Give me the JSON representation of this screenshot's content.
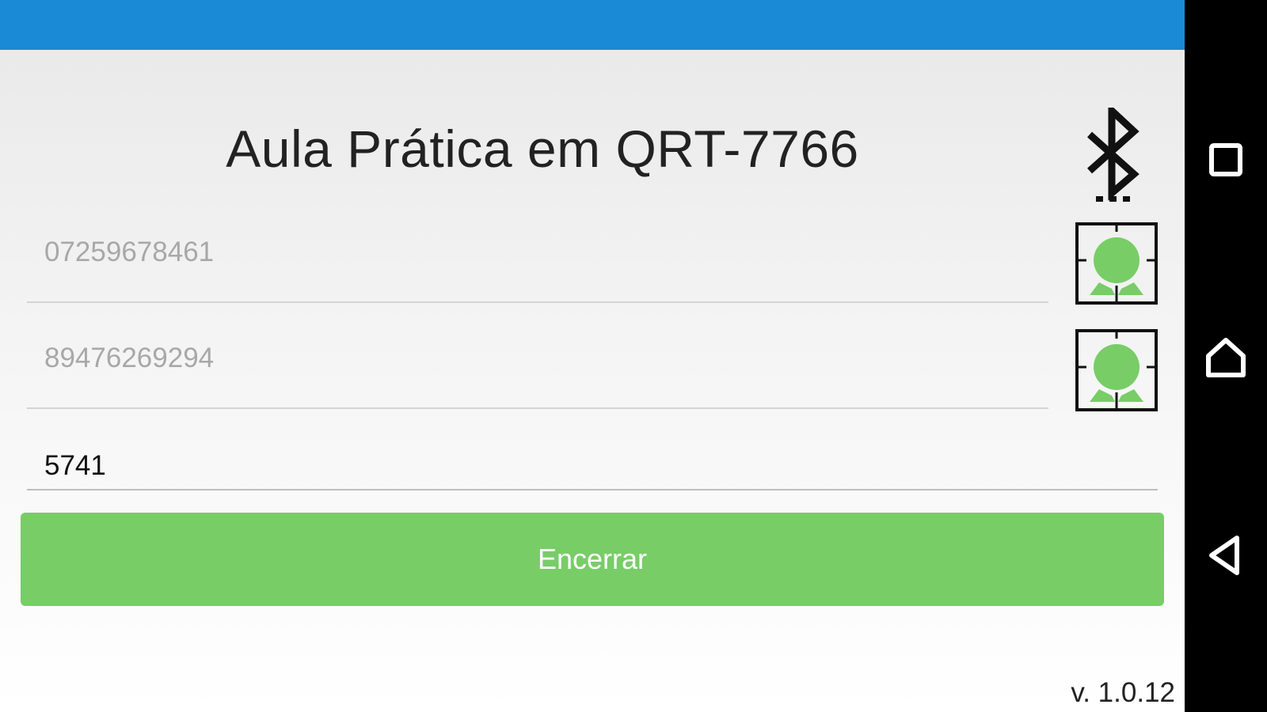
{
  "header": {
    "title": "Aula Prática em QRT-7766"
  },
  "fields": [
    {
      "placeholder": "07259678461",
      "value": ""
    },
    {
      "placeholder": "89476269294",
      "value": ""
    },
    {
      "placeholder": "",
      "value": "5741"
    }
  ],
  "actions": {
    "primary_label": "Encerrar"
  },
  "footer": {
    "version": "v. 1.0.12"
  },
  "icons": {
    "bluetooth": "bluetooth-icon",
    "scan": "qr-scan-person-icon",
    "nav_recent": "square-icon",
    "nav_home": "home-icon",
    "nav_back": "back-triangle-icon"
  },
  "colors": {
    "status_bar": "#1a8ad6",
    "accent_green": "#78cd67",
    "nav_bar": "#000000"
  }
}
